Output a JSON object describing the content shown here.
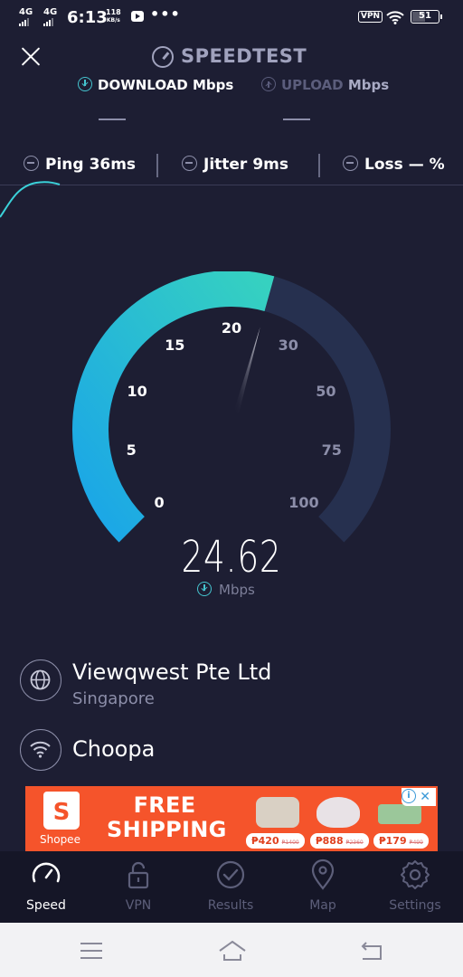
{
  "status_bar": {
    "network_1": "4G",
    "network_2": "4G",
    "time": "6:13",
    "speed_value": "118",
    "speed_unit": "KB/s",
    "more": "•••",
    "vpn": "VPN",
    "battery": "51"
  },
  "header": {
    "title": "SPEEDTEST",
    "download_label": "DOWNLOAD",
    "download_unit": "Mbps",
    "upload_label": "UPLOAD",
    "upload_unit": "Mbps",
    "download_value": "—",
    "upload_value": "—"
  },
  "metrics": {
    "ping_label": "Ping",
    "ping_value": "36ms",
    "jitter_label": "Jitter",
    "jitter_value": "9ms",
    "loss_label": "Loss",
    "loss_value": "— %"
  },
  "gauge": {
    "ticks": [
      "0",
      "5",
      "10",
      "15",
      "20",
      "30",
      "50",
      "75",
      "100"
    ],
    "current_value": "24.62",
    "unit": "Mbps",
    "colors": {
      "track": "#26304f",
      "fill_start": "#1aa5e8",
      "fill_end": "#36d1c0",
      "needle": "#ffffff"
    }
  },
  "server": {
    "provider": "Viewqwest Pte Ltd",
    "location": "Singapore",
    "host": "Choopa"
  },
  "ad": {
    "brand": "Shopee",
    "brand_letter": "S",
    "headline_1": "FREE",
    "headline_2": "SHIPPING",
    "prices": [
      {
        "price": "₱420",
        "old": "₱1400"
      },
      {
        "price": "₱888",
        "old": "₱2360"
      },
      {
        "price": "₱179",
        "old": "₱499"
      }
    ],
    "info": "i",
    "close": "✕"
  },
  "nav": {
    "speed": "Speed",
    "vpn": "VPN",
    "results": "Results",
    "map": "Map",
    "settings": "Settings"
  }
}
